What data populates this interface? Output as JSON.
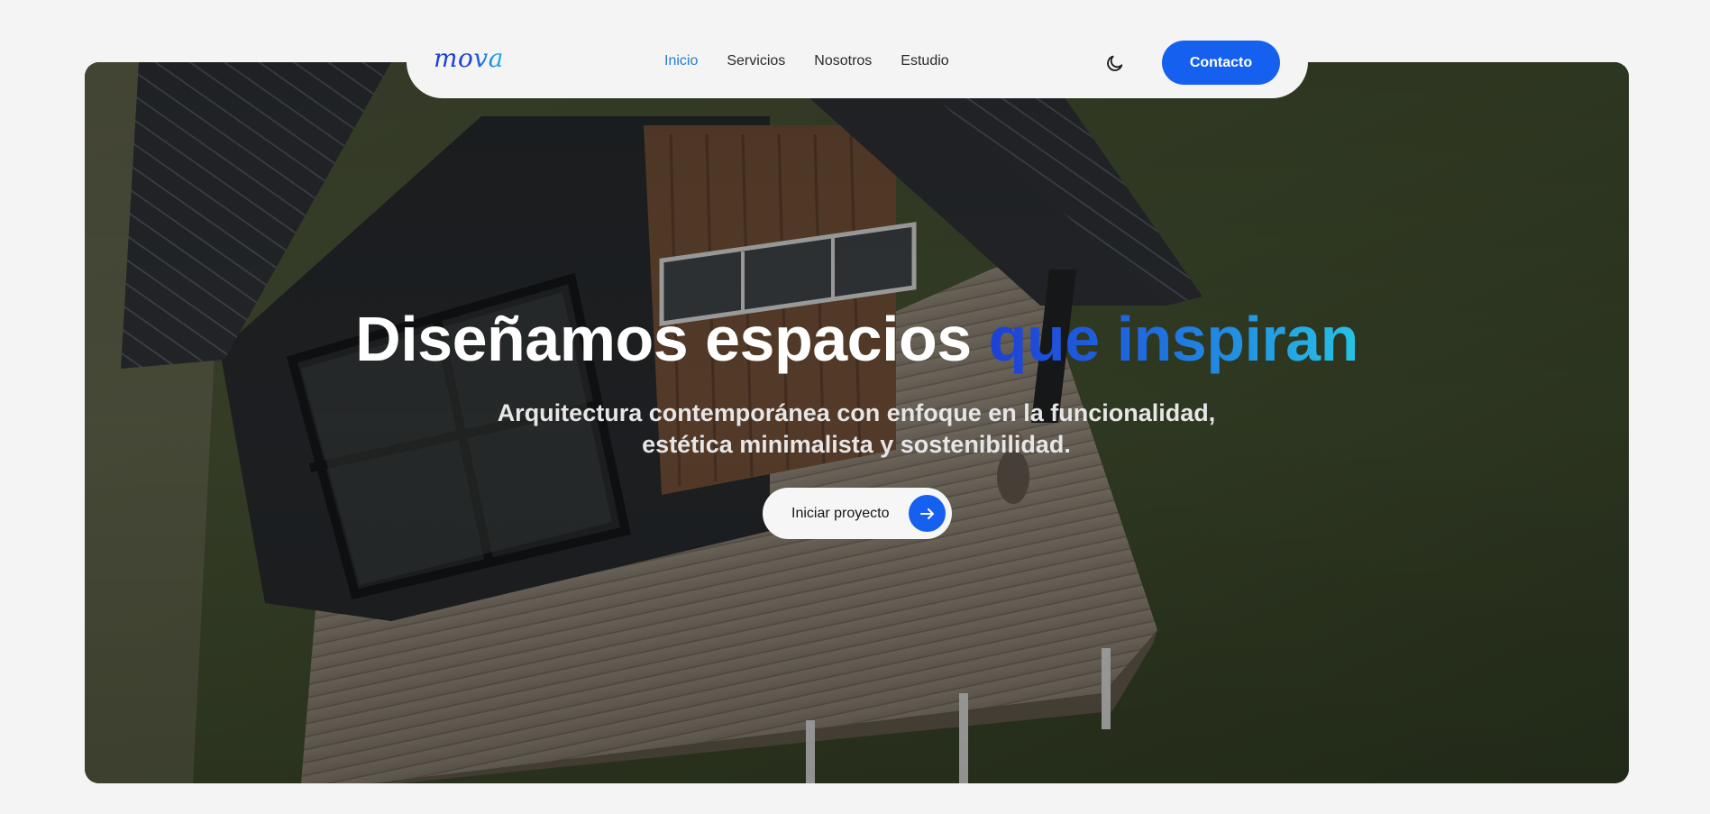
{
  "nav": {
    "logo": "mova",
    "links": [
      "Inicio",
      "Servicios",
      "Nosotros",
      "Estudio"
    ],
    "active_link": "Inicio",
    "contact_label": "Contacto",
    "theme_icon": "moon-icon"
  },
  "hero": {
    "title_plain": "Diseñamos espacios",
    "title_accent": "que inspiran",
    "subtitle_line1": "Arquitectura contemporánea con enfoque en la funcionalidad,",
    "subtitle_line2": "estética minimalista y sostenibilidad.",
    "cta_label": "Iniciar proyecto",
    "cta_icon": "arrow-right-icon"
  },
  "colors": {
    "accent": "#1660f0",
    "active_link": "#2b7bd6",
    "gradient_start": "#1d3fd6",
    "gradient_end": "#27c3e6",
    "page_background": "#f4f4f4"
  }
}
